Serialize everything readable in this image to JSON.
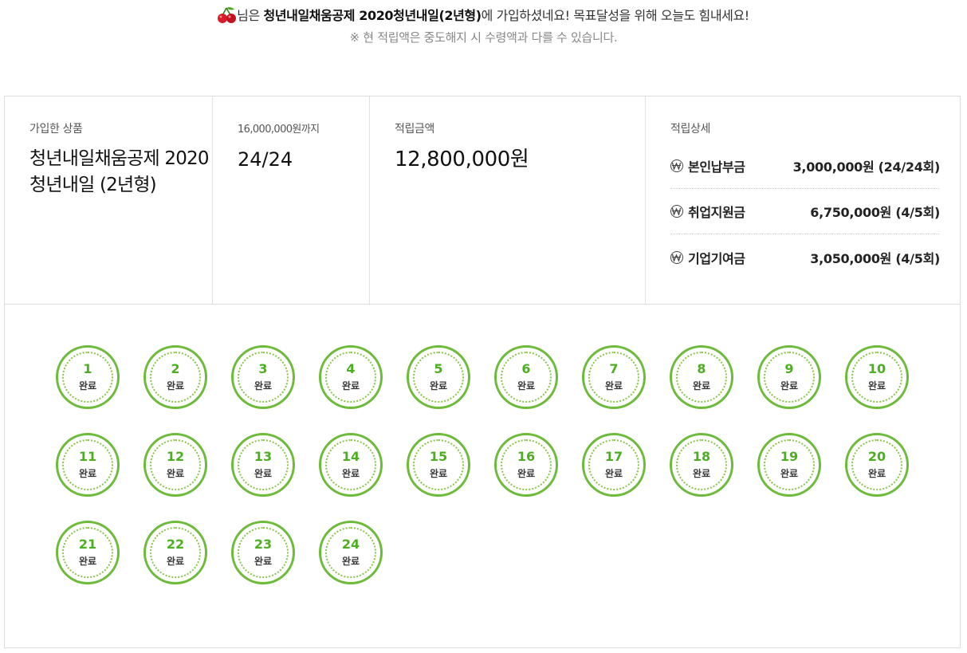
{
  "header": {
    "line1_suffix": "님은 ",
    "product_name": "청년내일채움공제 2020청년내일(2년형)",
    "line1_tail": "에 가입하셨네요! 목표달성을 위해 오늘도 힘내세요!",
    "notice": "※ 현 적립액은 중도해지 시 수령액과 다를 수 있습니다."
  },
  "summary": {
    "product": {
      "label": "가입한 상품",
      "value": "청년내일채움공제 2020청년내일 (2년형)"
    },
    "progress": {
      "label": "16,000,000원까지",
      "value": "24/24"
    },
    "amount": {
      "label": "적립금액",
      "value": "12,800,000원"
    },
    "details": {
      "label": "적립상세",
      "rows": [
        {
          "label": "본인납부금",
          "value": "3,000,000원 (24/24회)"
        },
        {
          "label": "취업지원금",
          "value": "6,750,000원 (4/5회)"
        },
        {
          "label": "기업기여금",
          "value": "3,050,000원 (4/5회)"
        }
      ]
    }
  },
  "stamps": {
    "status_label": "완료",
    "accent_color": "#6dbb3a",
    "items": [
      "1",
      "2",
      "3",
      "4",
      "5",
      "6",
      "7",
      "8",
      "9",
      "10",
      "11",
      "12",
      "13",
      "14",
      "15",
      "16",
      "17",
      "18",
      "19",
      "20",
      "21",
      "22",
      "23",
      "24"
    ]
  }
}
